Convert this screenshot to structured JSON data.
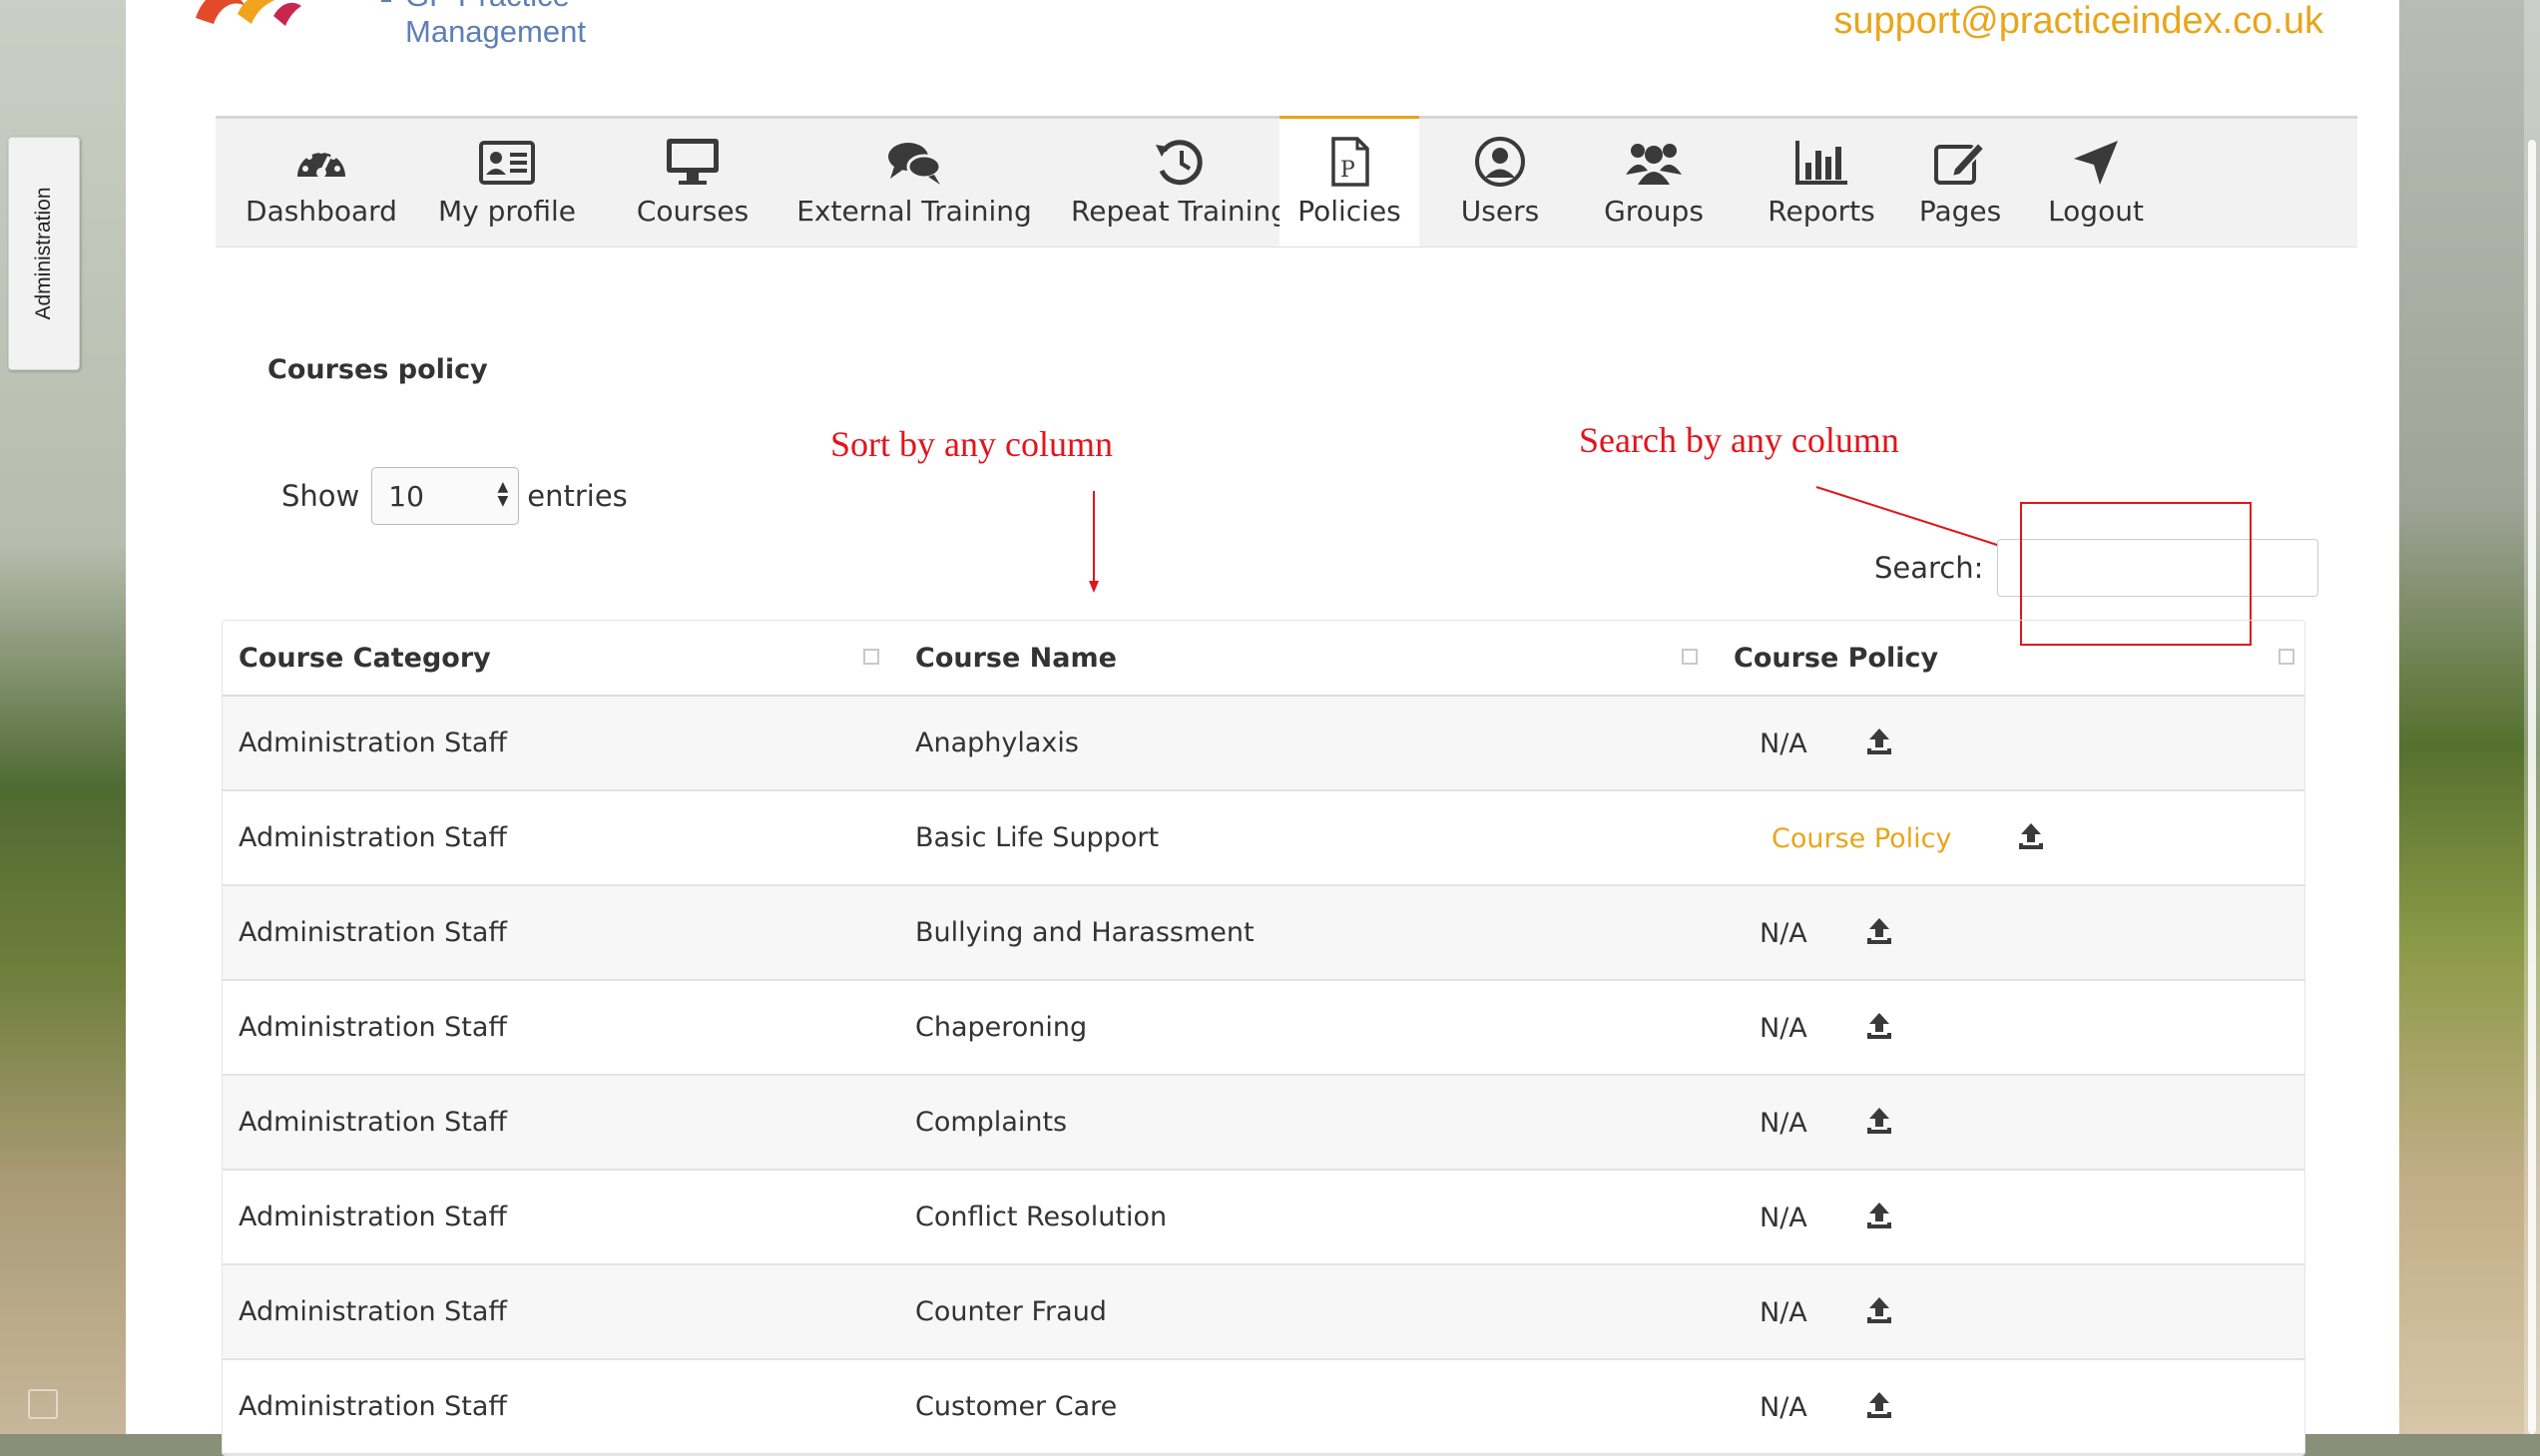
{
  "header": {
    "logo_text": "GP Practice Management",
    "support_email": "support@practiceindex.co.uk"
  },
  "side_tab": {
    "label": "Administration"
  },
  "nav": {
    "items": [
      {
        "label": "Dashboard",
        "icon": "dashboard-icon"
      },
      {
        "label": "My profile",
        "icon": "id-card-icon"
      },
      {
        "label": "Courses",
        "icon": "monitor-icon"
      },
      {
        "label": "External Training",
        "icon": "chat-bubbles-icon"
      },
      {
        "label": "Repeat Training",
        "icon": "history-icon"
      },
      {
        "label": "Policies",
        "icon": "policy-document-icon",
        "active": true
      },
      {
        "label": "Users",
        "icon": "user-circle-icon"
      },
      {
        "label": "Groups",
        "icon": "group-icon"
      },
      {
        "label": "Reports",
        "icon": "bar-chart-icon"
      },
      {
        "label": "Pages",
        "icon": "edit-page-icon"
      },
      {
        "label": "Logout",
        "icon": "location-arrow-icon"
      }
    ]
  },
  "content": {
    "title": "Courses policy",
    "length": {
      "show_label": "Show",
      "value": "10",
      "entries_label": "entries"
    },
    "search": {
      "label": "Search:",
      "value": ""
    },
    "annotations": {
      "sort": "Sort by any column",
      "search": "Search by any column"
    }
  },
  "table": {
    "columns": [
      "Course Category",
      "Course Name",
      "Course Policy"
    ],
    "rows": [
      {
        "category": "Administration Staff",
        "name": "Anaphylaxis",
        "policy": "N/A"
      },
      {
        "category": "Administration Staff",
        "name": "Basic Life Support",
        "policy": "Course Policy"
      },
      {
        "category": "Administration Staff",
        "name": "Bullying and Harassment",
        "policy": "N/A"
      },
      {
        "category": "Administration Staff",
        "name": "Chaperoning",
        "policy": "N/A"
      },
      {
        "category": "Administration Staff",
        "name": "Complaints",
        "policy": "N/A"
      },
      {
        "category": "Administration Staff",
        "name": "Conflict Resolution",
        "policy": "N/A"
      },
      {
        "category": "Administration Staff",
        "name": "Counter Fraud",
        "policy": "N/A"
      },
      {
        "category": "Administration Staff",
        "name": "Customer Care",
        "policy": "N/A"
      }
    ]
  },
  "colors": {
    "accent": "#e9a51a",
    "annotation_red": "#e3141b",
    "logo_blue": "#5e7fb6"
  }
}
